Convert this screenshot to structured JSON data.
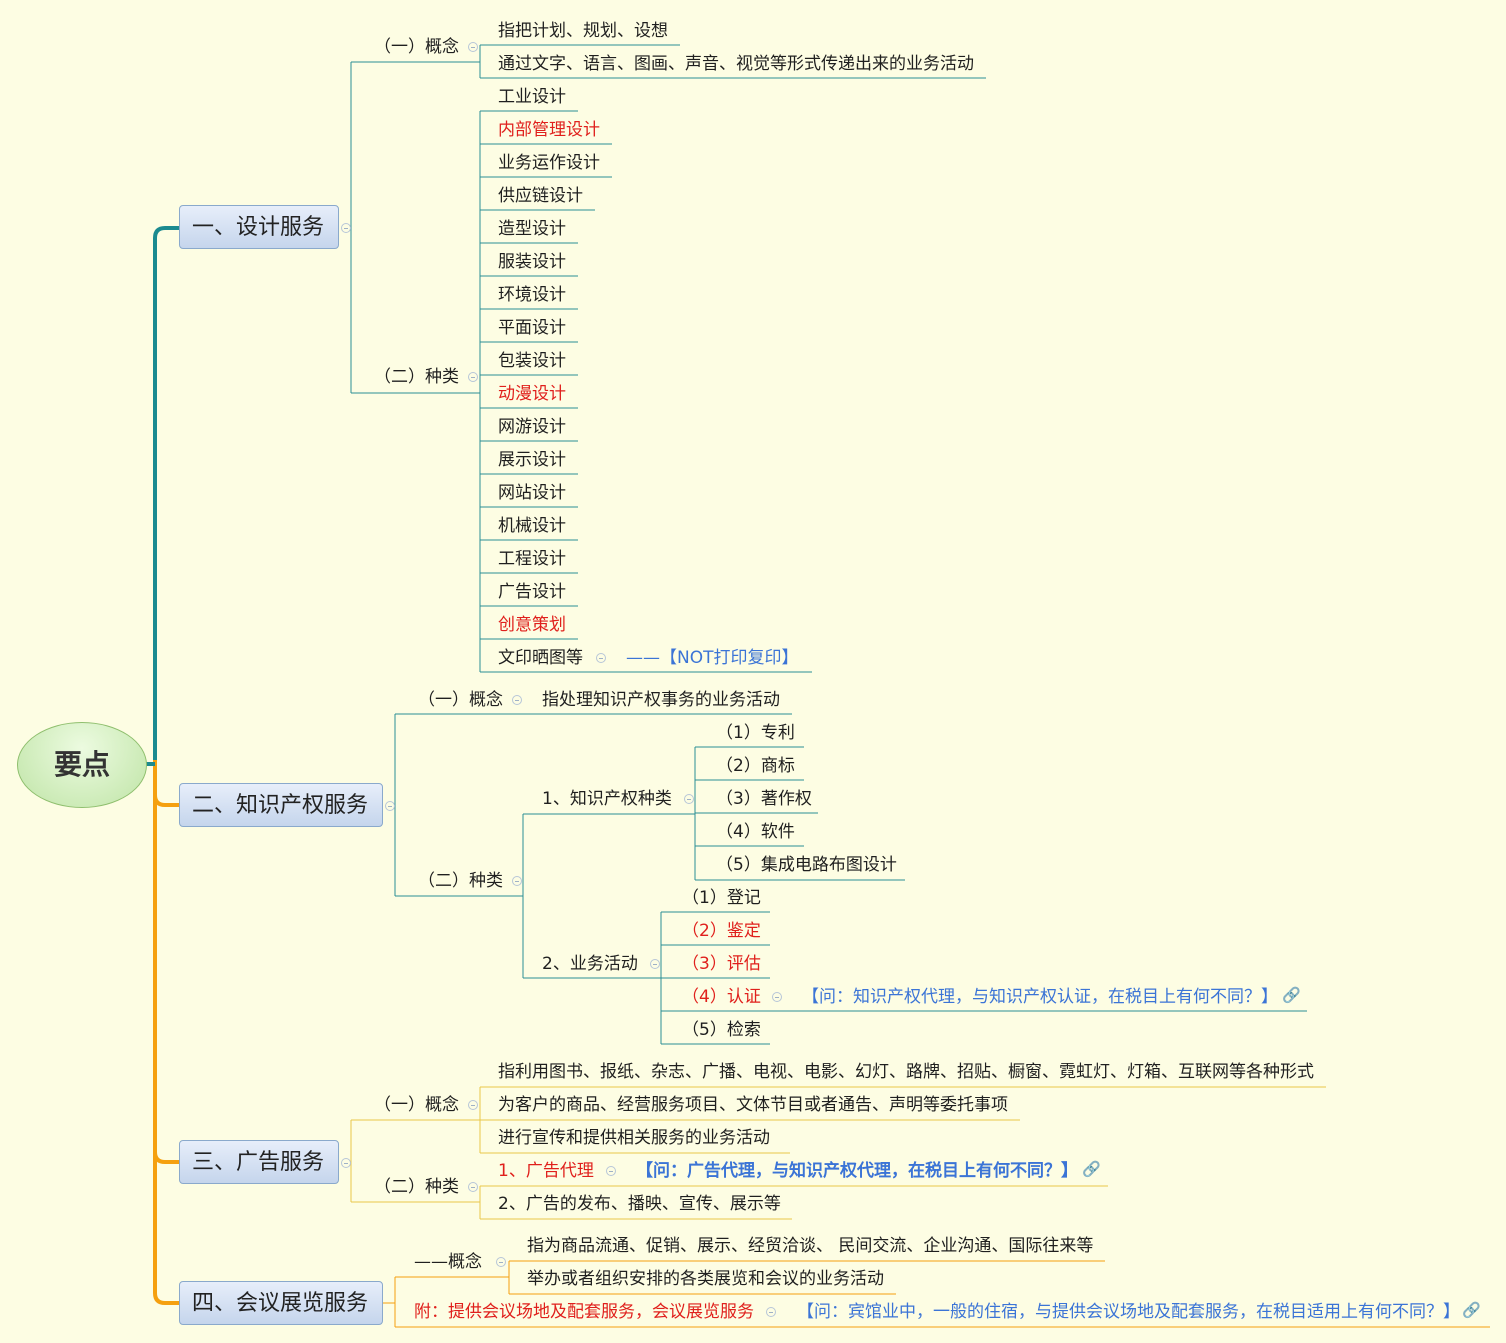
{
  "root": "要点",
  "colors": {
    "teal": "#1b8a8f",
    "orange": "#f5a00f",
    "red": "#e0201c",
    "blue": "#3b74d6"
  },
  "icons": {
    "collapse": "minus-circle-icon",
    "link": "link-icon"
  },
  "s1": {
    "title": "一、设计服务",
    "concept_label": "（一）概念",
    "concept_items": [
      "指把计划、规划、设想",
      "通过文字、语言、图画、声音、视觉等形式传递出来的业务活动"
    ],
    "types_label": "（二）种类",
    "types": [
      "工业设计",
      "内部管理设计",
      "业务运作设计",
      "供应链设计",
      "造型设计",
      "服装设计",
      "环境设计",
      "平面设计",
      "包装设计",
      "动漫设计",
      "网游设计",
      "展示设计",
      "网站设计",
      "机械设计",
      "工程设计",
      "广告设计",
      "创意策划",
      "文印晒图等"
    ],
    "note": "——【NOT打印复印】"
  },
  "s2": {
    "title": "二、知识产权服务",
    "concept_label": "（一）概念",
    "concept_item": "指处理知识产权事务的业务活动",
    "types_label": "（二）种类",
    "sub1_label": "1、知识产权种类",
    "sub1_items": [
      "（1）专利",
      "（2）商标",
      "（3）著作权",
      "（4）软件",
      "（5）集成电路布图设计"
    ],
    "sub2_label": "2、业务活动",
    "sub2_items": [
      "（1）登记",
      "（2）鉴定",
      "（3）评估",
      "（4）认证",
      "（5）检索"
    ],
    "question": "【问：知识产权代理，与知识产权认证，在税目上有何不同？】"
  },
  "s3": {
    "title": "三、广告服务",
    "concept_label": "（一）概念",
    "concept_items": [
      "指利用图书、报纸、杂志、广播、电视、电影、幻灯、路牌、招贴、橱窗、霓虹灯、灯箱、互联网等各种形式",
      "为客户的商品、经营服务项目、文体节目或者通告、声明等委托事项",
      "进行宣传和提供相关服务的业务活动"
    ],
    "types_label": "（二）种类",
    "types": [
      "1、广告代理",
      "2、广告的发布、播映、宣传、展示等"
    ],
    "question": "【问：广告代理，与知识产权代理，在税目上有何不同？】"
  },
  "s4": {
    "title": "四、会议展览服务",
    "concept_label": "——概念",
    "concept_items": [
      "指为商品流通、促销、展示、经贸洽谈、 民间交流、企业沟通、国际往来等",
      "举办或者组织安排的各类展览和会议的业务活动"
    ],
    "note": "附：提供会议场地及配套服务，会议展览服务",
    "question": "【问：宾馆业中，一般的住宿，与提供会议场地及配套服务，在税目适用上有何不同？】"
  }
}
